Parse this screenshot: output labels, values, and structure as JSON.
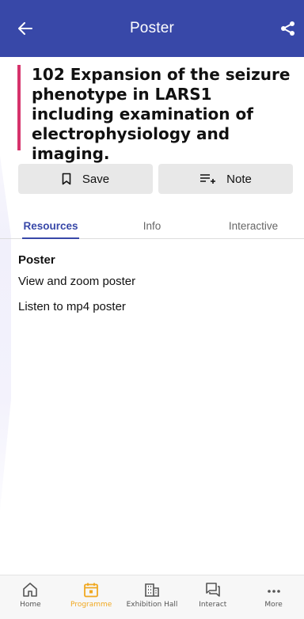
{
  "app_bar": {
    "title": "Poster",
    "back_icon": "arrow-left-icon",
    "share_icon": "share-icon",
    "background_color": "#3848a8"
  },
  "poster": {
    "title": "102 Expansion of the seizure phenotype in LARS1 including examination of electrophysiology and imaging.",
    "accent_color": "#d6336c"
  },
  "actions": {
    "save_label": "Save",
    "note_label": "Note"
  },
  "tabs": [
    {
      "label": "Resources",
      "active": true
    },
    {
      "label": "Info",
      "active": false
    },
    {
      "label": "Interactive",
      "active": false
    }
  ],
  "resources": {
    "heading": "Poster",
    "items": [
      "View and zoom poster",
      "Listen to mp4 poster"
    ]
  },
  "bottom_nav": {
    "active_color": "#f0a820",
    "items": [
      {
        "label": "Home",
        "icon": "home-icon",
        "active": false
      },
      {
        "label": "Programme",
        "icon": "calendar-icon",
        "active": true
      },
      {
        "label": "Exhibition Hall",
        "icon": "building-icon",
        "active": false
      },
      {
        "label": "Interact",
        "icon": "chat-icon",
        "active": false
      },
      {
        "label": "More",
        "icon": "more-icon",
        "active": false
      }
    ]
  }
}
